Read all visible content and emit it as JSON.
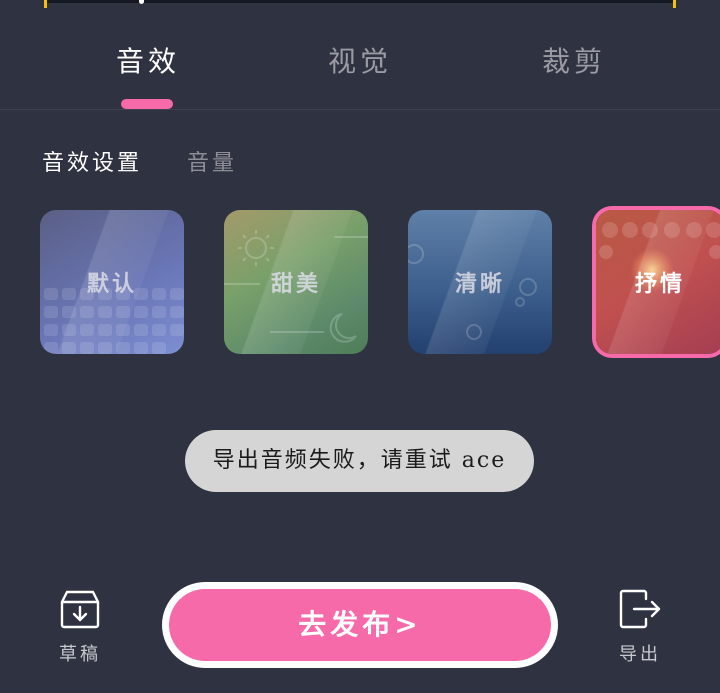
{
  "tabs": [
    {
      "label": "音效",
      "active": true
    },
    {
      "label": "视觉",
      "active": false
    },
    {
      "label": "裁剪",
      "active": false
    }
  ],
  "subtabs": [
    {
      "label": "音效设置",
      "active": true
    },
    {
      "label": "音量",
      "active": false
    }
  ],
  "effects": [
    {
      "label": "默认",
      "selected": false
    },
    {
      "label": "甜美",
      "selected": false
    },
    {
      "label": "清晰",
      "selected": false
    },
    {
      "label": "抒情",
      "selected": true
    }
  ],
  "toast": {
    "message": "导出音频失败，请重试 ace"
  },
  "bottom": {
    "draft_label": "草稿",
    "publish_label": "去发布>",
    "export_label": "导出"
  },
  "colors": {
    "accent": "#f76aa9",
    "background": "#2f3240",
    "timeline_marker": "#f3c300"
  },
  "icons": {
    "draft": "inbox-download-icon",
    "export": "exit-arrow-icon"
  }
}
